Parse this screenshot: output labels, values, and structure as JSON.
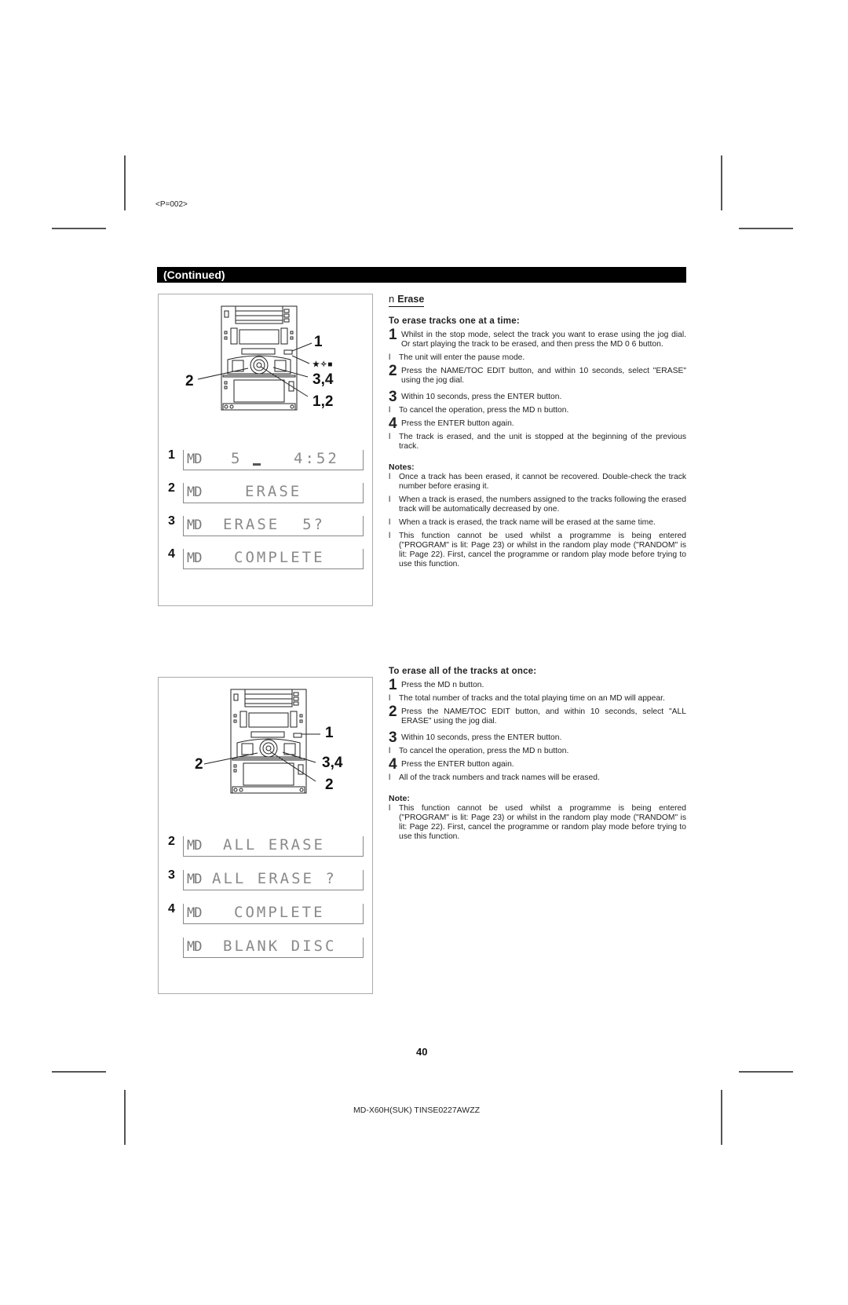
{
  "page_code": "<P=002>",
  "header_bar": "(Continued)",
  "section": {
    "bullet": "n",
    "title": "Erase"
  },
  "one_at_a_time": {
    "heading": "To erase tracks one at a time:",
    "items": [
      {
        "type": "step",
        "num": "1",
        "text": "Whilst in the stop mode, select the track you want to erase using the jog dial. Or start playing the track to be erased, and then press the MD 0 6   button."
      },
      {
        "type": "bullet",
        "mark": "l",
        "text": "The unit will enter the pause mode."
      },
      {
        "type": "step",
        "num": "2",
        "text": "Press the NAME/TOC EDIT button, and within 10 seconds, select \"ERASE\" using the jog dial."
      },
      {
        "type": "step",
        "num": "3",
        "text": "Within 10 seconds, press the ENTER button."
      },
      {
        "type": "bullet",
        "mark": "l",
        "text": "To cancel the operation, press the MD n  button."
      },
      {
        "type": "step",
        "num": "4",
        "text": "Press the ENTER button again."
      },
      {
        "type": "bullet",
        "mark": "l",
        "text": "The track is erased, and the unit is stopped at the beginning of the previous track."
      }
    ],
    "notes_heading": "Notes:",
    "notes": [
      "Once a track has been erased, it cannot be recovered. Double-check the track number before erasing it.",
      "When a track is erased, the numbers assigned to the tracks following the erased track will be automatically decreased by one.",
      "When a track is erased, the track name will be erased at the same time.",
      "This function cannot be used whilst a programme is being entered (\"PROGRAM\" is lit: Page 23) or whilst in the random play mode (\"RANDOM\" is lit: Page 22). First, cancel the programme or random play mode before trying to use this function."
    ]
  },
  "all_at_once": {
    "heading": "To erase all of the tracks at once:",
    "items": [
      {
        "type": "step",
        "num": "1",
        "text": "Press the MD n  button."
      },
      {
        "type": "bullet",
        "mark": "l",
        "text": "The total number of tracks and the total playing time on an MD will appear."
      },
      {
        "type": "step",
        "num": "2",
        "text": "Press the NAME/TOC EDIT button, and within 10 seconds, select \"ALL ERASE\" using the jog dial."
      },
      {
        "type": "step",
        "num": "3",
        "text": "Within 10 seconds, press the ENTER button."
      },
      {
        "type": "bullet",
        "mark": "l",
        "text": "To cancel the operation, press the MD n  button."
      },
      {
        "type": "step",
        "num": "4",
        "text": "Press the ENTER button again."
      },
      {
        "type": "bullet",
        "mark": "l",
        "text": "All of the track numbers and track names will be erased."
      }
    ],
    "note_heading": "Note:",
    "notes": [
      "This function cannot be used whilst a programme is being entered (\"PROGRAM\" is lit: Page 23) or whilst in the random play mode (\"RANDOM\" is lit: Page 22). First, cancel the programme or random play mode before trying to use this function."
    ]
  },
  "figure_top": {
    "callouts": {
      "c1": "1",
      "c_sym": "★✧■",
      "c34": "3,4",
      "c12": "1,2",
      "c2": "2"
    },
    "displays": [
      {
        "step": "1",
        "md": "MD",
        "text": "5",
        "text2": "4:52"
      },
      {
        "step": "2",
        "md": "MD",
        "text": "ERASE"
      },
      {
        "step": "3",
        "md": "MD",
        "text": "ERASE  5?"
      },
      {
        "step": "4",
        "md": "MD",
        "text": "COMPLETE"
      }
    ]
  },
  "figure_bottom": {
    "callouts": {
      "c1": "1",
      "c34": "3,4",
      "c2b": "2",
      "c2": "2"
    },
    "displays": [
      {
        "step": "2",
        "md": "MD",
        "text": "ALL ERASE"
      },
      {
        "step": "3",
        "md": "MD",
        "text": "ALL ERASE ?"
      },
      {
        "step": "4",
        "md": "MD",
        "text": "COMPLETE"
      },
      {
        "step": "",
        "md": "MD",
        "text": "BLANK DISC"
      }
    ]
  },
  "page_number": "40",
  "model_code": "MD-X60H(SUK) TINSE0227AWZZ"
}
